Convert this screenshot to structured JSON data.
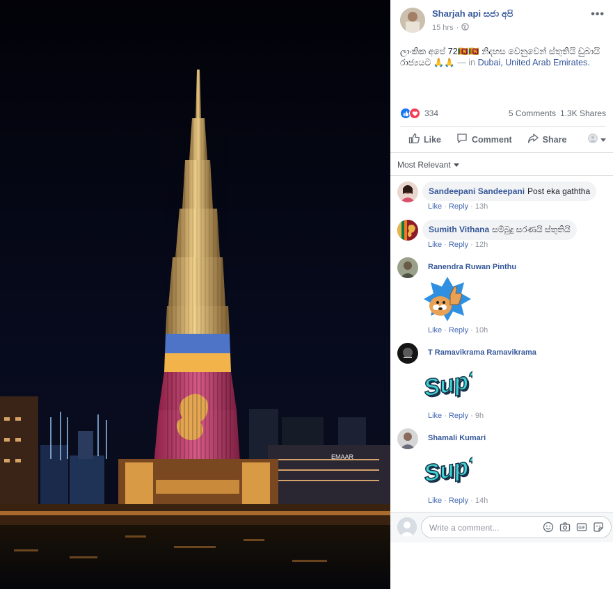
{
  "post": {
    "page_name": "Sharjah api සජා අපි",
    "time": "15 hrs",
    "globe_icon": "globe-icon",
    "menu_icon": "more-options-icon",
    "caption_text": "ලාංකික අපේ 72🇱🇰🇱🇰 නිදහස වෙනුවෙන් ස්තුතියි ඩුබායි රාජ්‍යයට 🙏🙏",
    "caption_dash": " — in ",
    "location_city": "Dubai",
    "location_sep": ", ",
    "location_country": "United Arab Emirates",
    "location_end": "."
  },
  "stats": {
    "reaction_count": "334",
    "comments": "5 Comments",
    "shares": "1.3K Shares"
  },
  "actions": {
    "like": "Like",
    "comment": "Comment",
    "share": "Share"
  },
  "sort": {
    "label": "Most Relevant"
  },
  "comments": [
    {
      "author": "Sandeepani Sandeepani",
      "text": "Post eka gaththa",
      "like": "Like",
      "reply": "Reply",
      "time": "13h"
    },
    {
      "author": "Sumith Vithana",
      "text": "සම්බුදු සරණයි ස්තුතියි",
      "like": "Like",
      "reply": "Reply",
      "time": "12h"
    },
    {
      "author": "Ranendra Ruwan Pinthu",
      "sticker": "thumbs-up-puppy-sticker",
      "like": "Like",
      "reply": "Reply",
      "time": "10h"
    },
    {
      "author": "T Ramavikrama Ramavikrama",
      "sticker": "sup-sticker",
      "like": "Like",
      "reply": "Reply",
      "time": "9h"
    },
    {
      "author": "Shamali Kumari",
      "sticker": "sup-sticker",
      "like": "Like",
      "reply": "Reply",
      "time": "14h"
    }
  ],
  "sticker_text": "Sup?",
  "composer": {
    "placeholder": "Write a comment..."
  },
  "colors": {
    "link": "#365899",
    "action_link": "#4267b2",
    "muted": "#90949c",
    "like_blue": "#1877f2",
    "love_red": "#f33e58",
    "flag_maroon": "#c9355f",
    "flag_gold": "#e8b54a"
  }
}
